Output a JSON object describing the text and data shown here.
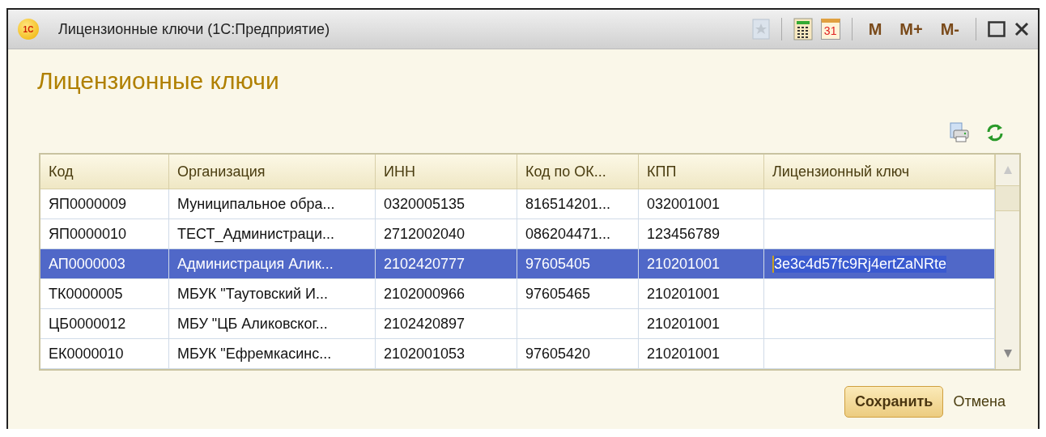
{
  "window": {
    "title": "Лицензионные ключи  (1С:Предприятие)",
    "logo": "1С",
    "calendar_day": "31",
    "memory_buttons": [
      "M",
      "M+",
      "M-"
    ]
  },
  "heading": "Лицензионные ключи",
  "table": {
    "columns": [
      "Код",
      "Организация",
      "ИНН",
      "Код по ОК...",
      "КПП",
      "Лицензионный ключ"
    ],
    "rows": [
      {
        "cells": [
          "ЯП0000009",
          "Муниципальное обра...",
          "0320005135",
          "816514201...",
          "032001001",
          ""
        ],
        "selected": false
      },
      {
        "cells": [
          "ЯП0000010",
          "ТЕСТ_Администраци...",
          "2712002040",
          "086204471...",
          "123456789",
          ""
        ],
        "selected": false
      },
      {
        "cells": [
          "АП0000003",
          "Администрация Алик...",
          "2102420777",
          "97605405",
          "210201001",
          "3e3c4d57fc9Rj4ertZaNRte"
        ],
        "selected": true
      },
      {
        "cells": [
          "ТК0000005",
          "МБУК \"Таутовский И...",
          "2102000966",
          "97605465",
          "210201001",
          ""
        ],
        "selected": false
      },
      {
        "cells": [
          "ЦБ0000012",
          "МБУ \"ЦБ Аликовског...",
          "2102420897",
          "",
          "210201001",
          ""
        ],
        "selected": false
      },
      {
        "cells": [
          "ЕК0000010",
          "МБУК \"Ефремкасинс...",
          "2102001053",
          "97605420",
          "210201001",
          ""
        ],
        "selected": false
      }
    ]
  },
  "buttons": {
    "save": "Сохранить",
    "cancel": "Отмена"
  }
}
